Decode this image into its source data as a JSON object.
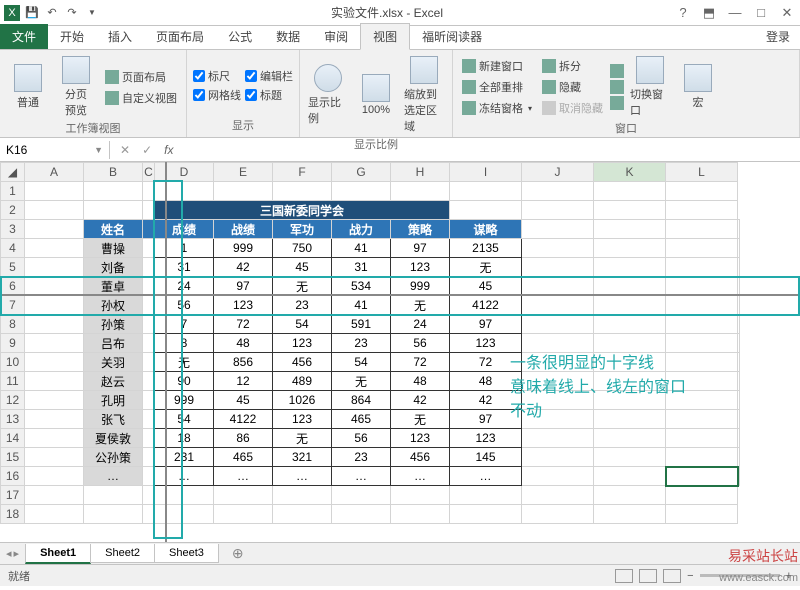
{
  "titlebar": {
    "title": "实验文件.xlsx - Excel"
  },
  "win": {
    "help": "?",
    "menu": "⬒",
    "min": "—",
    "max": "□",
    "close": "✕"
  },
  "tabs": {
    "file": "文件",
    "home": "开始",
    "insert": "插入",
    "pagelayout": "页面布局",
    "formulas": "公式",
    "data": "数据",
    "review": "审阅",
    "view": "视图",
    "foxit": "福昕阅读器",
    "login": "登录"
  },
  "ribbon": {
    "normal": "普通",
    "pagebreak": "分页\n预览",
    "pagelayout": "页面布局",
    "custom": "自定义视图",
    "ruler": "标尺",
    "formula": "编辑栏",
    "gridlines": "网格线",
    "headings": "标题",
    "zoom": "显示比例",
    "z100": "100%",
    "zoomsel": "缩放到\n选定区域",
    "newwin": "新建窗口",
    "arrange": "全部重排",
    "freeze": "冻结窗格",
    "split": "拆分",
    "hide": "隐藏",
    "unhide": "取消隐藏",
    "switchwin": "切换窗口",
    "macro": "宏",
    "g1": "工作簿视图",
    "g2": "显示",
    "g3": "显示比例",
    "g4": "窗口"
  },
  "namebox": "K16",
  "columns": [
    "A",
    "B",
    "C",
    "D",
    "E",
    "F",
    "G",
    "H",
    "I",
    "J",
    "K",
    "L"
  ],
  "table": {
    "title": "三国新委同学会",
    "headers": [
      "姓名",
      "成绩",
      "战绩",
      "军功",
      "战力",
      "策略",
      "谋略"
    ],
    "rows": [
      [
        "曹操",
        "1",
        "999",
        "750",
        "41",
        "97",
        "2135"
      ],
      [
        "刘备",
        "31",
        "42",
        "45",
        "31",
        "123",
        "无"
      ],
      [
        "董卓",
        "24",
        "97",
        "无",
        "534",
        "999",
        "45"
      ],
      [
        "孙权",
        "56",
        "123",
        "23",
        "41",
        "无",
        "4122"
      ],
      [
        "孙策",
        "7",
        "72",
        "54",
        "591",
        "24",
        "97"
      ],
      [
        "吕布",
        "8",
        "48",
        "123",
        "23",
        "56",
        "123"
      ],
      [
        "关羽",
        "无",
        "856",
        "456",
        "54",
        "72",
        "72"
      ],
      [
        "赵云",
        "90",
        "12",
        "489",
        "无",
        "48",
        "48"
      ],
      [
        "孔明",
        "999",
        "45",
        "1026",
        "864",
        "42",
        "42"
      ],
      [
        "张飞",
        "54",
        "4122",
        "123",
        "465",
        "无",
        "97"
      ],
      [
        "夏侯敦",
        "18",
        "86",
        "无",
        "56",
        "123",
        "123"
      ],
      [
        "公孙策",
        "231",
        "465",
        "321",
        "23",
        "456",
        "145"
      ],
      [
        "…",
        "…",
        "…",
        "…",
        "…",
        "…",
        "…"
      ]
    ]
  },
  "annotation": {
    "l1": "一条很明显的十字线",
    "l2": "意味着线上、线左的窗口",
    "l3": "不动"
  },
  "sheets": {
    "s1": "Sheet1",
    "s2": "Sheet2",
    "s3": "Sheet3",
    "add": "⊕"
  },
  "status": {
    "ready": "就绪"
  },
  "watermark": {
    "main": "易采站长站",
    "sub": "www.easck.com"
  }
}
